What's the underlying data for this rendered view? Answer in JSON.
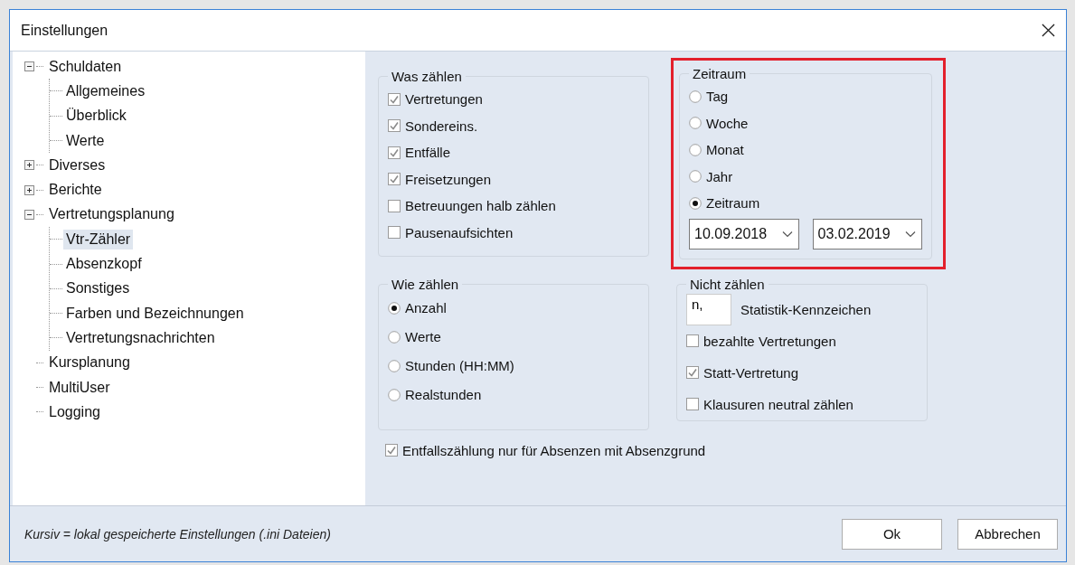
{
  "window": {
    "title": "Einstellungen"
  },
  "tree": [
    {
      "label": "Schuldaten",
      "expanded": true,
      "selected": false,
      "children": [
        {
          "label": "Allgemeines",
          "selected": false
        },
        {
          "label": "Überblick",
          "selected": false
        },
        {
          "label": "Werte",
          "selected": false
        }
      ]
    },
    {
      "label": "Diverses",
      "expanded": false,
      "selected": false
    },
    {
      "label": "Berichte",
      "expanded": false,
      "selected": false
    },
    {
      "label": "Vertretungsplanung",
      "expanded": true,
      "selected": false,
      "children": [
        {
          "label": "Vtr-Zähler",
          "selected": true
        },
        {
          "label": "Absenzkopf",
          "selected": false
        },
        {
          "label": "Sonstiges",
          "selected": false
        },
        {
          "label": "Farben und Bezeichnungen",
          "selected": false
        },
        {
          "label": "Vertretungsnachrichten",
          "selected": false
        }
      ]
    },
    {
      "label": "Kursplanung",
      "selected": false
    },
    {
      "label": "MultiUser",
      "selected": false
    },
    {
      "label": "Logging",
      "selected": false
    }
  ],
  "groups": [
    {
      "title": "Was zählen",
      "highlighted": false,
      "items": [
        {
          "kind": "checkbox",
          "label": "Vertretungen",
          "checked": true
        },
        {
          "kind": "checkbox",
          "label": "Sondereins.",
          "checked": true
        },
        {
          "kind": "checkbox",
          "label": "Entfälle",
          "checked": true
        },
        {
          "kind": "checkbox",
          "label": "Freisetzungen",
          "checked": true
        },
        {
          "kind": "checkbox",
          "label": "Betreuungen halb zählen",
          "checked": false
        },
        {
          "kind": "checkbox",
          "label": "Pausenaufsichten",
          "checked": false
        }
      ]
    },
    {
      "title": "Zeitraum",
      "highlighted": true,
      "items": [
        {
          "kind": "radio",
          "label": "Tag",
          "selected": false
        },
        {
          "kind": "radio",
          "label": "Woche",
          "selected": false
        },
        {
          "kind": "radio",
          "label": "Monat",
          "selected": false
        },
        {
          "kind": "radio",
          "label": "Jahr",
          "selected": false
        },
        {
          "kind": "radio",
          "label": "Zeitraum",
          "selected": true
        },
        {
          "kind": "dates",
          "values": [
            "10.09.2018",
            "03.02.2019"
          ]
        }
      ]
    },
    {
      "title": "Wie zählen",
      "highlighted": false,
      "items": [
        {
          "kind": "radio",
          "label": "Anzahl",
          "selected": true
        },
        {
          "kind": "radio",
          "label": "Werte",
          "selected": false
        },
        {
          "kind": "radio",
          "label": "Stunden (HH:MM)",
          "selected": false
        },
        {
          "kind": "radio",
          "label": "Realstunden",
          "selected": false
        }
      ]
    },
    {
      "title": "Nicht zählen",
      "highlighted": false,
      "items": [
        {
          "kind": "textfield",
          "value": "n,",
          "label": "Statistik-Kennzeichen"
        },
        {
          "kind": "checkbox",
          "label": "bezahlte Vertretungen",
          "checked": false
        },
        {
          "kind": "checkbox",
          "label": "Statt-Vertretung",
          "checked": true
        },
        {
          "kind": "checkbox",
          "label": "Klausuren neutral zählen",
          "checked": false
        }
      ]
    }
  ],
  "bottom_option": {
    "label": "Entfallszählung nur für Absenzen mit Absenzgrund",
    "checked": true
  },
  "footer": {
    "note": "Kursiv = lokal gespeicherte Einstellungen (.ini Dateien)",
    "buttons": [
      "Ok",
      "Abbrechen"
    ]
  }
}
